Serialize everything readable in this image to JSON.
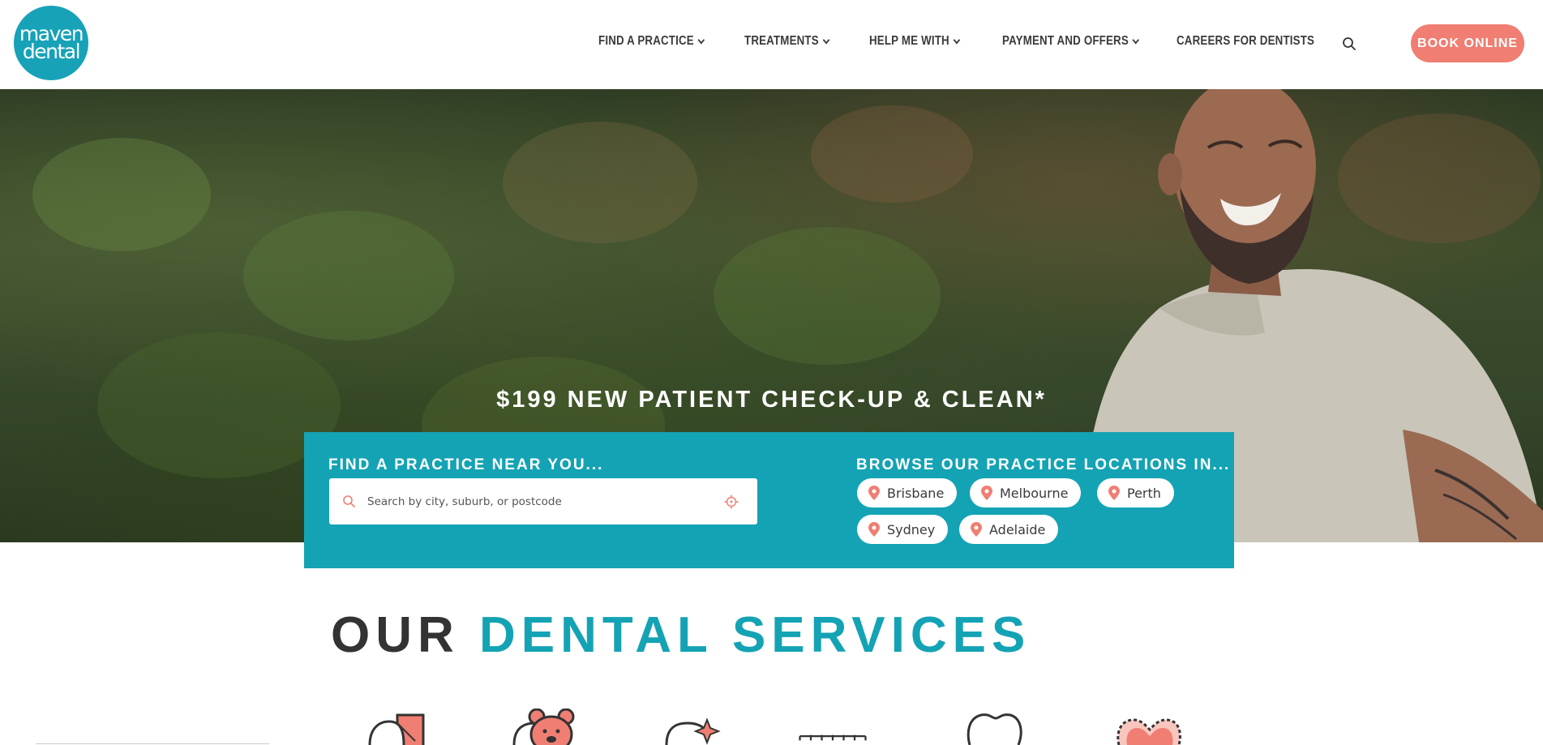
{
  "header": {
    "logo": {
      "line1": "maven",
      "line2": "dental"
    },
    "nav": [
      {
        "label": "FIND A PRACTICE",
        "has_dropdown": true
      },
      {
        "label": "TREATMENTS",
        "has_dropdown": true
      },
      {
        "label": "HELP ME WITH",
        "has_dropdown": true
      },
      {
        "label": "PAYMENT AND OFFERS",
        "has_dropdown": true
      },
      {
        "label": "CAREERS FOR DENTISTS",
        "has_dropdown": false
      }
    ],
    "search_icon": "search-icon",
    "book_label": "BOOK ONLINE"
  },
  "hero": {
    "tagline": "$199 NEW PATIENT CHECK-UP & CLEAN*"
  },
  "finder": {
    "find_title": "FIND A PRACTICE NEAR YOU...",
    "search_placeholder": "Search by city, suburb, or postcode",
    "browse_title": "BROWSE OUR PRACTICE LOCATIONS IN...",
    "locations": [
      "Brisbane",
      "Melbourne",
      "Perth",
      "Sydney",
      "Adelaide"
    ]
  },
  "services": {
    "title_part1": "OUR",
    "title_part2": "DENTAL SERVICES",
    "icons": [
      "general-dentistry-icon",
      "children-dentistry-icon",
      "teeth-whitening-icon",
      "braces-icon",
      "tooth-icon",
      "emergency-heart-icon"
    ]
  },
  "colors": {
    "brand_teal": "#14a3b4",
    "accent_coral": "#f07e72",
    "text_dark": "#333333"
  }
}
